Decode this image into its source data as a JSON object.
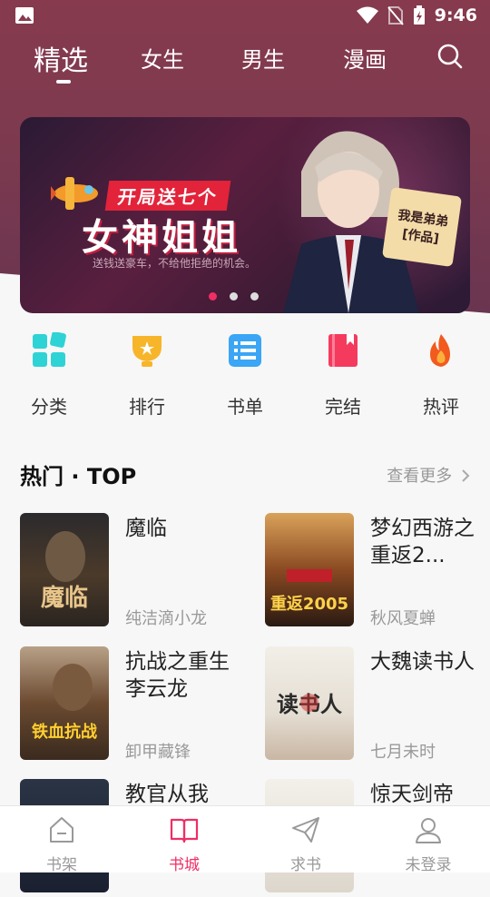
{
  "status_bar": {
    "time": "9:46"
  },
  "tabs": [
    {
      "label": "精选"
    },
    {
      "label": "女生"
    },
    {
      "label": "男生"
    },
    {
      "label": "漫画"
    }
  ],
  "banner": {
    "tag": "开局送七个",
    "headline": "女神姐姐",
    "subline": "送钱送豪车，不给他拒绝的机会。",
    "badge_line1": "我是弟弟",
    "badge_line2": "[作品]",
    "slide_count": 3,
    "active_slide": 1
  },
  "categories": [
    {
      "label": "分类",
      "icon": "grid-icon",
      "color": "#2ed3d6"
    },
    {
      "label": "排行",
      "icon": "trophy-icon",
      "color": "#f7b52a"
    },
    {
      "label": "书单",
      "icon": "list-icon",
      "color": "#3aa6f5"
    },
    {
      "label": "完结",
      "icon": "book-icon",
      "color": "#f43b5e"
    },
    {
      "label": "热评",
      "icon": "flame-icon",
      "color": "#f25a1e"
    }
  ],
  "section": {
    "title": "热门 · TOP",
    "more": "查看更多"
  },
  "books": [
    {
      "title": "魔临",
      "author": "纯洁滴小龙",
      "cover_text": "魔临"
    },
    {
      "title": "梦幻西游之重返2...",
      "author": "秋风夏蝉",
      "cover_text": "重返2005"
    },
    {
      "title": "抗战之重生李云龙",
      "author": "卸甲藏锋",
      "cover_text": "铁血抗战"
    },
    {
      "title": "大魏读书人",
      "author": "七月未时",
      "cover_text": "读书人"
    },
    {
      "title": "教官从我",
      "author": "",
      "cover_text": ""
    },
    {
      "title": "惊天剑帝",
      "author": "",
      "cover_text": ""
    }
  ],
  "bottom_nav": [
    {
      "label": "书架",
      "icon": "bookshelf-icon"
    },
    {
      "label": "书城",
      "icon": "open-book-icon",
      "active": true
    },
    {
      "label": "求书",
      "icon": "paper-plane-icon"
    },
    {
      "label": "未登录",
      "icon": "user-icon"
    }
  ],
  "colors": {
    "accent": "#ef2e64",
    "header_bg": "#873a4e"
  }
}
